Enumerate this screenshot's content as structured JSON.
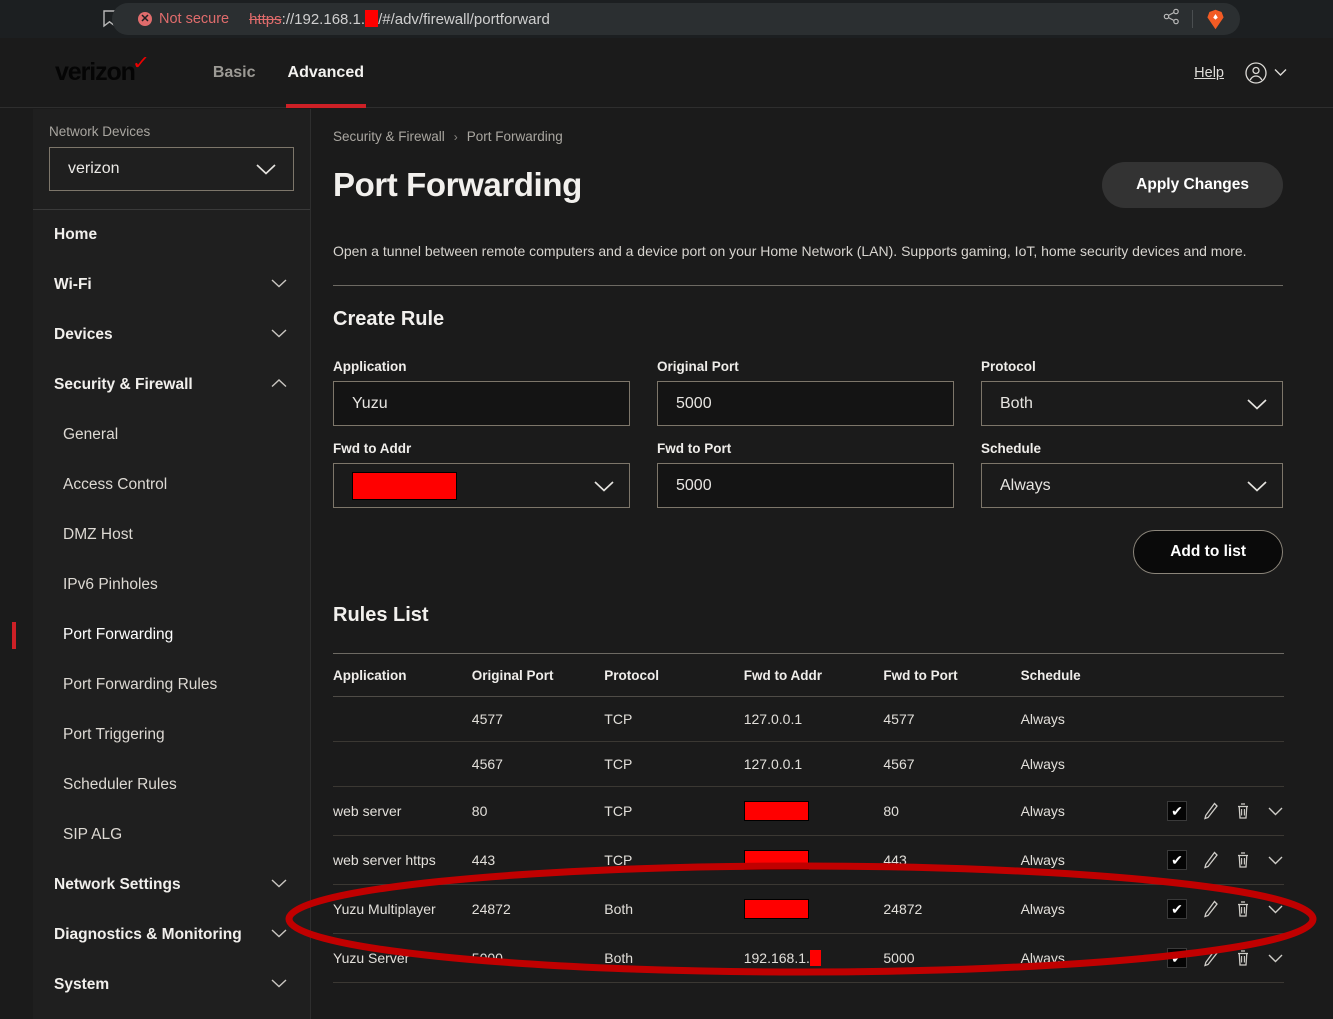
{
  "browser": {
    "security_label": "Not secure",
    "url_scheme": "https",
    "url_rest": "://192.168.1.",
    "url_path": "/#/adv/firewall/portforward",
    "bookmark_icon": "bookmark-icon",
    "share_icon": "share-icon",
    "brave_icon": "brave-lion-icon"
  },
  "header": {
    "logo_text": "verizon",
    "nav": [
      {
        "label": "Basic",
        "active": false
      },
      {
        "label": "Advanced",
        "active": true
      }
    ],
    "help_label": "Help",
    "account_icon": "account-circle-icon"
  },
  "sidebar": {
    "network_devices_label": "Network Devices",
    "device_selected": "verizon",
    "items": [
      {
        "label": "Home",
        "type": "group",
        "expandable": false
      },
      {
        "label": "Wi-Fi",
        "type": "group",
        "expandable": true,
        "state": "collapsed"
      },
      {
        "label": "Devices",
        "type": "group",
        "expandable": true,
        "state": "collapsed"
      },
      {
        "label": "Security & Firewall",
        "type": "group",
        "expandable": true,
        "state": "expanded"
      },
      {
        "label": "General",
        "type": "sub",
        "active": false
      },
      {
        "label": "Access Control",
        "type": "sub",
        "active": false
      },
      {
        "label": "DMZ Host",
        "type": "sub",
        "active": false
      },
      {
        "label": "IPv6 Pinholes",
        "type": "sub",
        "active": false
      },
      {
        "label": "Port Forwarding",
        "type": "sub",
        "active": true
      },
      {
        "label": "Port Forwarding Rules",
        "type": "sub",
        "active": false
      },
      {
        "label": "Port Triggering",
        "type": "sub",
        "active": false
      },
      {
        "label": "Scheduler Rules",
        "type": "sub",
        "active": false
      },
      {
        "label": "SIP ALG",
        "type": "sub",
        "active": false
      },
      {
        "label": "Network Settings",
        "type": "group",
        "expandable": true,
        "state": "collapsed"
      },
      {
        "label": "Diagnostics & Monitoring",
        "type": "group",
        "expandable": true,
        "state": "collapsed"
      },
      {
        "label": "System",
        "type": "group",
        "expandable": true,
        "state": "collapsed"
      }
    ]
  },
  "main": {
    "breadcrumb": {
      "parent": "Security & Firewall",
      "separator": "›",
      "current": "Port Forwarding"
    },
    "page_title": "Port Forwarding",
    "apply_button": "Apply Changes",
    "description": "Open a tunnel between remote computers and a device port on your Home Network (LAN). Supports gaming, IoT, home security devices and more.",
    "create_rule_title": "Create Rule",
    "form": {
      "application": {
        "label": "Application",
        "value": "Yuzu"
      },
      "original_port": {
        "label": "Original Port",
        "value": "5000"
      },
      "protocol": {
        "label": "Protocol",
        "value": "Both"
      },
      "fwd_to_addr": {
        "label": "Fwd to Addr",
        "value": "[redacted]"
      },
      "fwd_to_port": {
        "label": "Fwd to Port",
        "value": "5000"
      },
      "schedule": {
        "label": "Schedule",
        "value": "Always"
      }
    },
    "add_to_list_button": "Add to list",
    "rules_list_title": "Rules List",
    "table": {
      "columns": [
        "Application",
        "Original Port",
        "Protocol",
        "Fwd to Addr",
        "Fwd to Port",
        "Schedule"
      ],
      "rows": [
        {
          "application": "",
          "original_port": "4577",
          "protocol": "TCP",
          "fwd_to_addr": "127.0.0.1",
          "fwd_to_port": "4577",
          "schedule": "Always",
          "has_actions": false,
          "checked": false
        },
        {
          "application": "",
          "original_port": "4567",
          "protocol": "TCP",
          "fwd_to_addr": "127.0.0.1",
          "fwd_to_port": "4567",
          "schedule": "Always",
          "has_actions": false,
          "checked": false
        },
        {
          "application": "web server",
          "original_port": "80",
          "protocol": "TCP",
          "fwd_to_addr": "[redacted]",
          "fwd_to_port": "80",
          "schedule": "Always",
          "has_actions": true,
          "checked": true
        },
        {
          "application": "web server https",
          "original_port": "443",
          "protocol": "TCP",
          "fwd_to_addr": "[redacted]",
          "fwd_to_port": "443",
          "schedule": "Always",
          "has_actions": true,
          "checked": true
        },
        {
          "application": "Yuzu Multiplayer",
          "original_port": "24872",
          "protocol": "Both",
          "fwd_to_addr": "[redacted]",
          "fwd_to_port": "24872",
          "schedule": "Always",
          "has_actions": true,
          "checked": true
        },
        {
          "application": "Yuzu Server",
          "original_port": "5000",
          "protocol": "Both",
          "fwd_to_addr": "192.168.1.",
          "fwd_to_port": "5000",
          "schedule": "Always",
          "has_actions": true,
          "checked": true
        }
      ],
      "action_icons": [
        "checkbox-checked-icon",
        "edit-pencil-icon",
        "trash-delete-icon",
        "chevron-down-icon"
      ]
    }
  },
  "annotation": {
    "shape": "ellipse",
    "color": "#c00000"
  },
  "colors": {
    "accent_red": "#cd2026",
    "redaction_red": "#ff0000",
    "page_bg": "#1b1b1b",
    "sidebar_bg": "#1f1f1f",
    "border": "#7d766a"
  }
}
